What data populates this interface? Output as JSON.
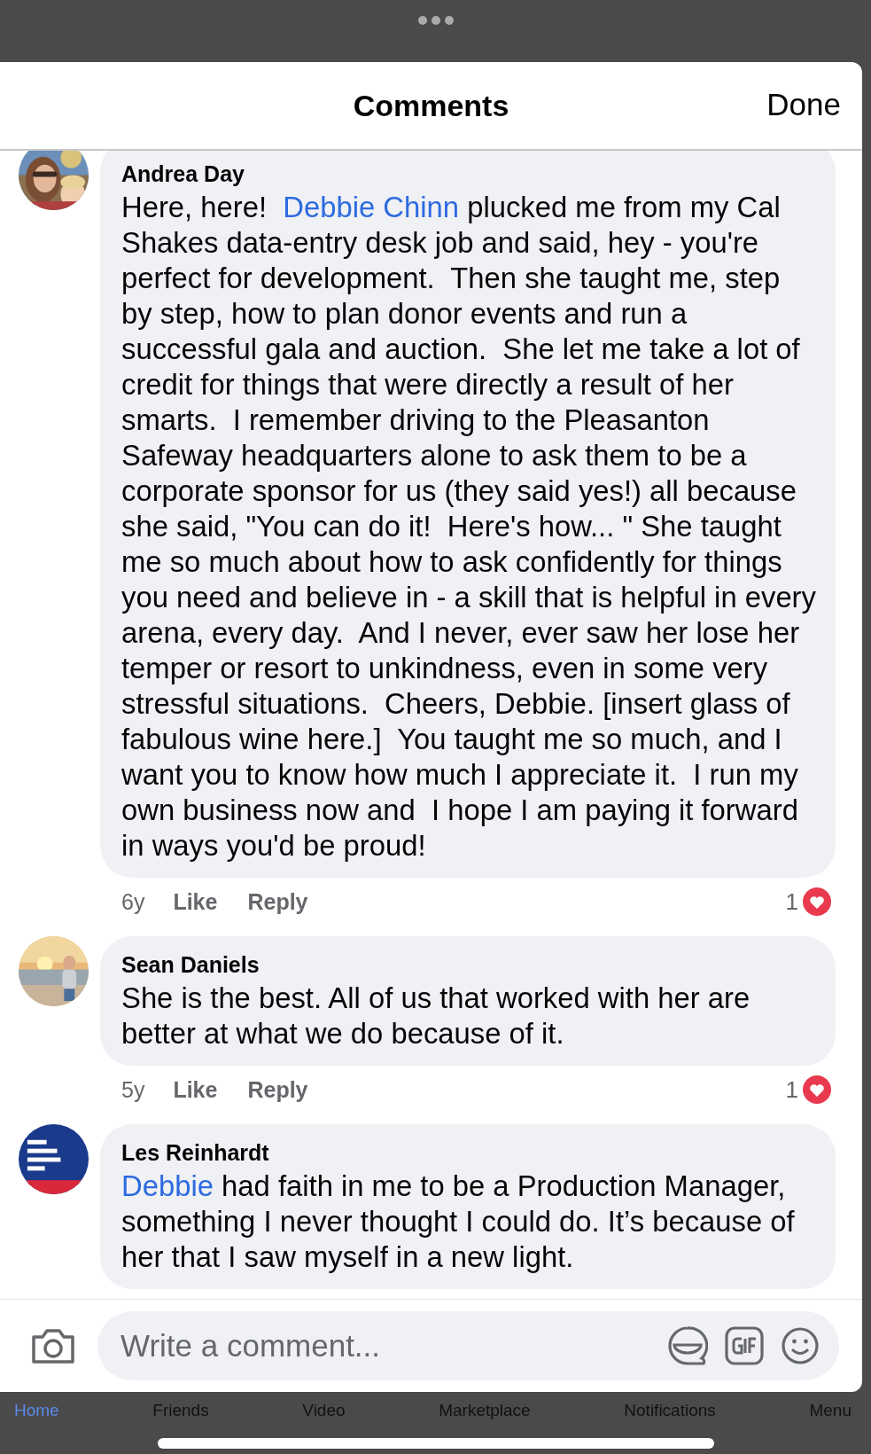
{
  "sheet": {
    "title": "Comments",
    "done_button": "Done"
  },
  "comments": [
    {
      "author": "Andrea Day",
      "segments": [
        {
          "kind": "plain",
          "text": "Here, here!  "
        },
        {
          "kind": "mention",
          "text": "Debbie Chinn"
        },
        {
          "kind": "plain",
          "text": " plucked me from my Cal Shakes data-entry desk job and said, hey - you're perfect for development.  Then she taught me, step by step, how to plan donor events and run a successful gala and auction.  She let me take a lot of credit for things that were directly a result of her smarts.  I remember driving to the Pleasanton Safeway headquarters alone to ask them to be a corporate sponsor for us (they said yes!) all because she said, \"You can do it!  Here's how... \" She taught me so much about how to ask confidently for things you need and believe in - a skill that is helpful in every arena, every day.  And I never, ever saw her lose her temper or resort to unkindness, even in some very stressful situations.  Cheers, Debbie. [insert glass of fabulous wine here.]  You taught me so much, and I want you to know how much I appreciate it.  I run my own business now and  I hope I am paying it forward in ways you'd be proud!"
        }
      ],
      "time": "6y",
      "like": "Like",
      "reply": "Reply",
      "reactions": "1",
      "kind": "picture"
    },
    {
      "author": "Sean Daniels",
      "segments": [
        {
          "kind": "plain",
          "text": "She is the best. All of us that worked with her are better at what we do because of it."
        }
      ],
      "time": "5y",
      "like": "Like",
      "reply": "Reply",
      "reactions": "1",
      "kind": "picture"
    },
    {
      "author": "Les Reinhardt",
      "segments": [
        {
          "kind": "mention",
          "text": "Debbie"
        },
        {
          "kind": "plain",
          "text": " had faith in me to be a Production Manager, something I never thought I could do. It’s because of her that I saw myself in a new light."
        }
      ],
      "kind": "picture"
    }
  ],
  "composer": {
    "placeholder": "Write a comment..."
  },
  "tab_bar": [
    {
      "label": "Home",
      "selected": true
    },
    {
      "label": "Friends",
      "selected": false
    },
    {
      "label": "Video",
      "selected": false
    },
    {
      "label": "Marketplace",
      "selected": false
    },
    {
      "label": "Notifications",
      "selected": false
    },
    {
      "label": "Menu",
      "selected": false
    }
  ]
}
